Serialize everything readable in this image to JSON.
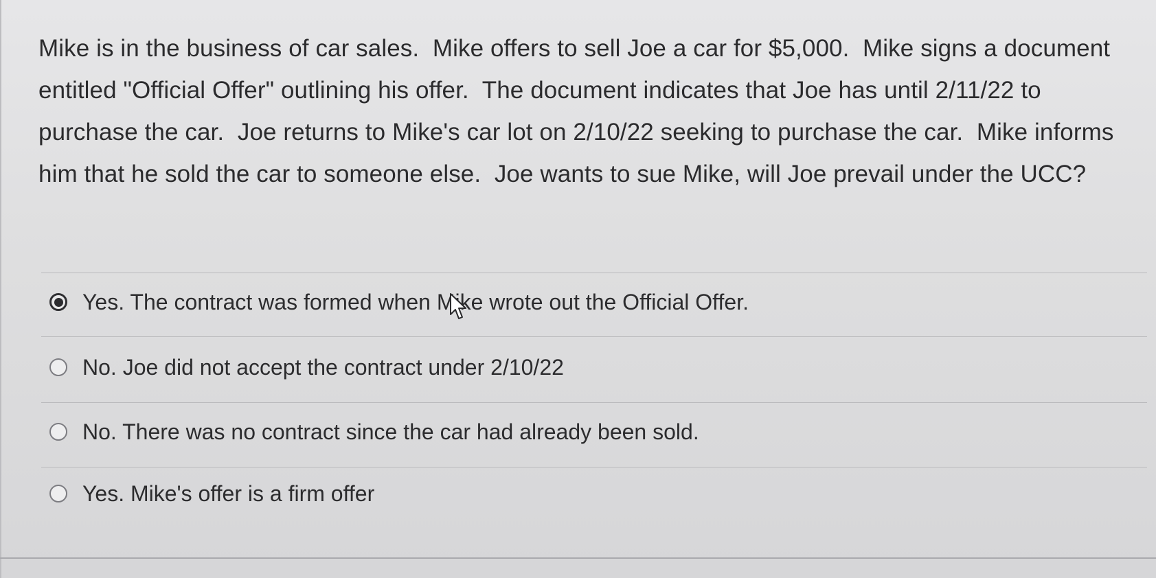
{
  "question": {
    "text": "Mike is in the business of car sales.  Mike offers to sell Joe a car for $5,000.  Mike signs a document entitled \"Official Offer\" outlining his offer.  The document indicates that Joe has until 2/11/22 to purchase the car.  Joe returns to Mike's car lot on 2/10/22 seeking to purchase the car.  Mike informs him that he sold the car to someone else.  Joe wants to sue Mike, will Joe prevail under the UCC?"
  },
  "answers": [
    {
      "label": "Yes. The contract was formed when Mike wrote out the Official Offer.",
      "selected": true
    },
    {
      "label": "No. Joe did not accept the contract under 2/10/22",
      "selected": false
    },
    {
      "label": "No. There was no contract since the car had already been sold.",
      "selected": false
    },
    {
      "label": "Yes. Mike's offer is a firm offer",
      "selected": false
    }
  ],
  "icons": {
    "cursor": "mouse-pointer-icon",
    "radio_selected": "radio-selected-icon",
    "radio_unselected": "radio-unselected-icon"
  },
  "colors": {
    "background": "#e2e2e4",
    "text": "#2b2b2d",
    "divider": "#b9b9bc",
    "radio_border": "#7d7d82"
  }
}
